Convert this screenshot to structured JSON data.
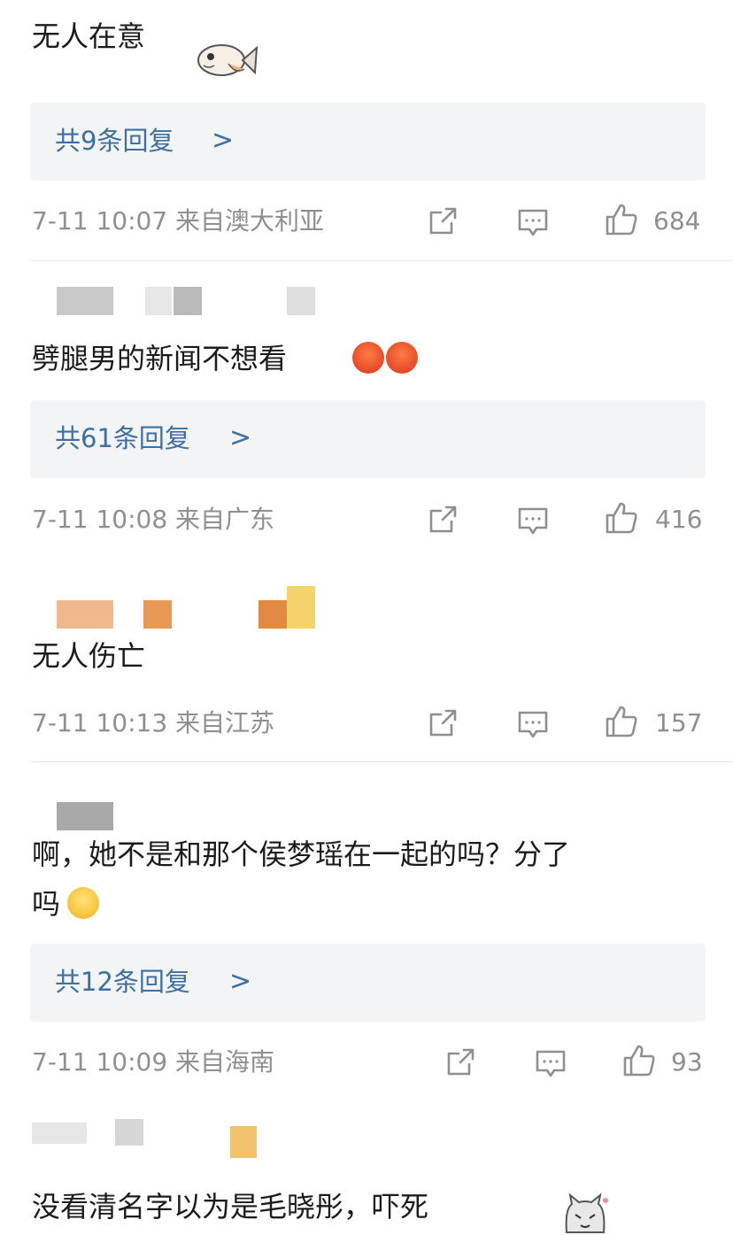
{
  "comments": [
    {
      "text": "无人在意",
      "replies": "共9条回复",
      "chev": ">",
      "time": "7-11 10:07 来自澳大利亚",
      "likes": "684"
    },
    {
      "text": "劈腿男的新闻不想看",
      "replies": "共61条回复",
      "chev": ">",
      "time": "7-11 10:08 来自广东",
      "likes": "416"
    },
    {
      "text": "无人伤亡",
      "time": "7-11 10:13 来自江苏",
      "likes": "157"
    },
    {
      "text_line1": "啊，她不是和那个侯梦瑶在一起的吗？分了",
      "text_line2": "吗",
      "replies": "共12条回复",
      "chev": ">",
      "time": "7-11 10:09 来自海南",
      "likes": "93"
    },
    {
      "text": "没看清名字以为是毛晓彤，吓死"
    }
  ],
  "icons": {
    "share": "share-icon",
    "comment": "comment-icon",
    "like": "thumbs-up-icon"
  },
  "colors": {
    "link": "#3d6fa3",
    "meta": "#8f8f8f",
    "reply_bg": "#f3f4f6"
  }
}
